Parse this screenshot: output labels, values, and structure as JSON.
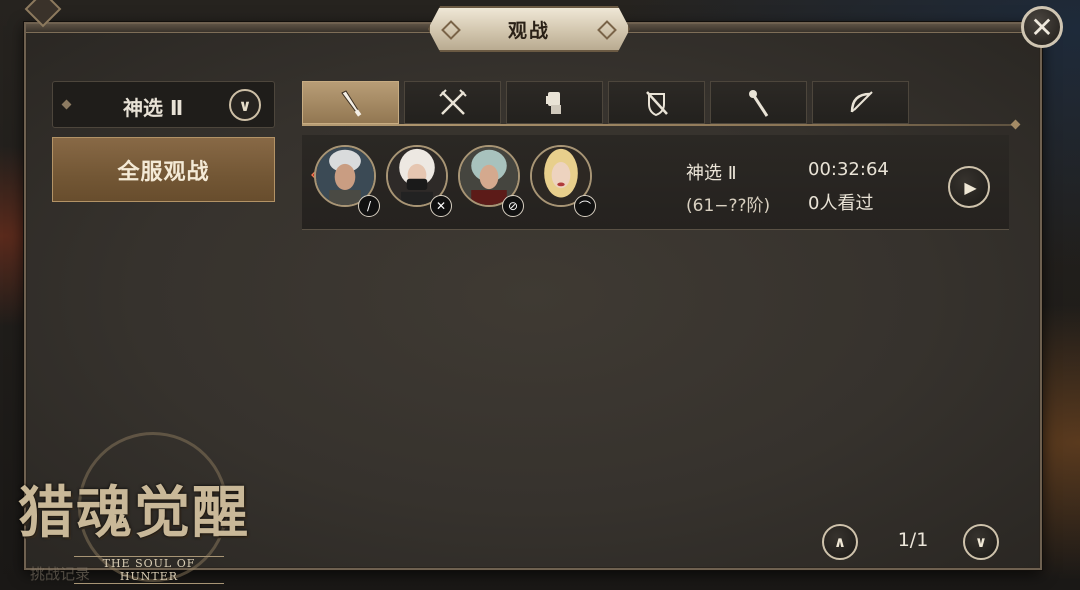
{
  "header": {
    "title": "观战"
  },
  "server_select": {
    "label": "神选 Ⅱ"
  },
  "sidebar": {
    "all_server_label": "全服观战"
  },
  "tabs": [
    {
      "icon": "dagger-icon",
      "active": true
    },
    {
      "icon": "crossed-swords-icon",
      "active": false
    },
    {
      "icon": "gauntlet-icon",
      "active": false
    },
    {
      "icon": "shield-sword-icon",
      "active": false
    },
    {
      "icon": "staff-icon",
      "active": false
    },
    {
      "icon": "bow-icon",
      "active": false
    }
  ],
  "match": {
    "server": "神选 Ⅱ",
    "level_range": "(61−??阶)",
    "time": "00:32:64",
    "viewers": "0人看过",
    "players": [
      {
        "portrait": "white-haired-male",
        "class_icon": "dagger-icon"
      },
      {
        "portrait": "masked-white-haired-female",
        "class_icon": "crossed-swords-icon"
      },
      {
        "portrait": "silver-haired-female",
        "class_icon": "shield-sword-icon"
      },
      {
        "portrait": "blonde-female",
        "class_icon": "bow-icon"
      }
    ]
  },
  "pager": {
    "text": "1/1"
  },
  "logo": {
    "title": "猎魂觉醒",
    "subtitle": "THE SOUL OF HUNTER"
  },
  "background_text": "挑战记录"
}
